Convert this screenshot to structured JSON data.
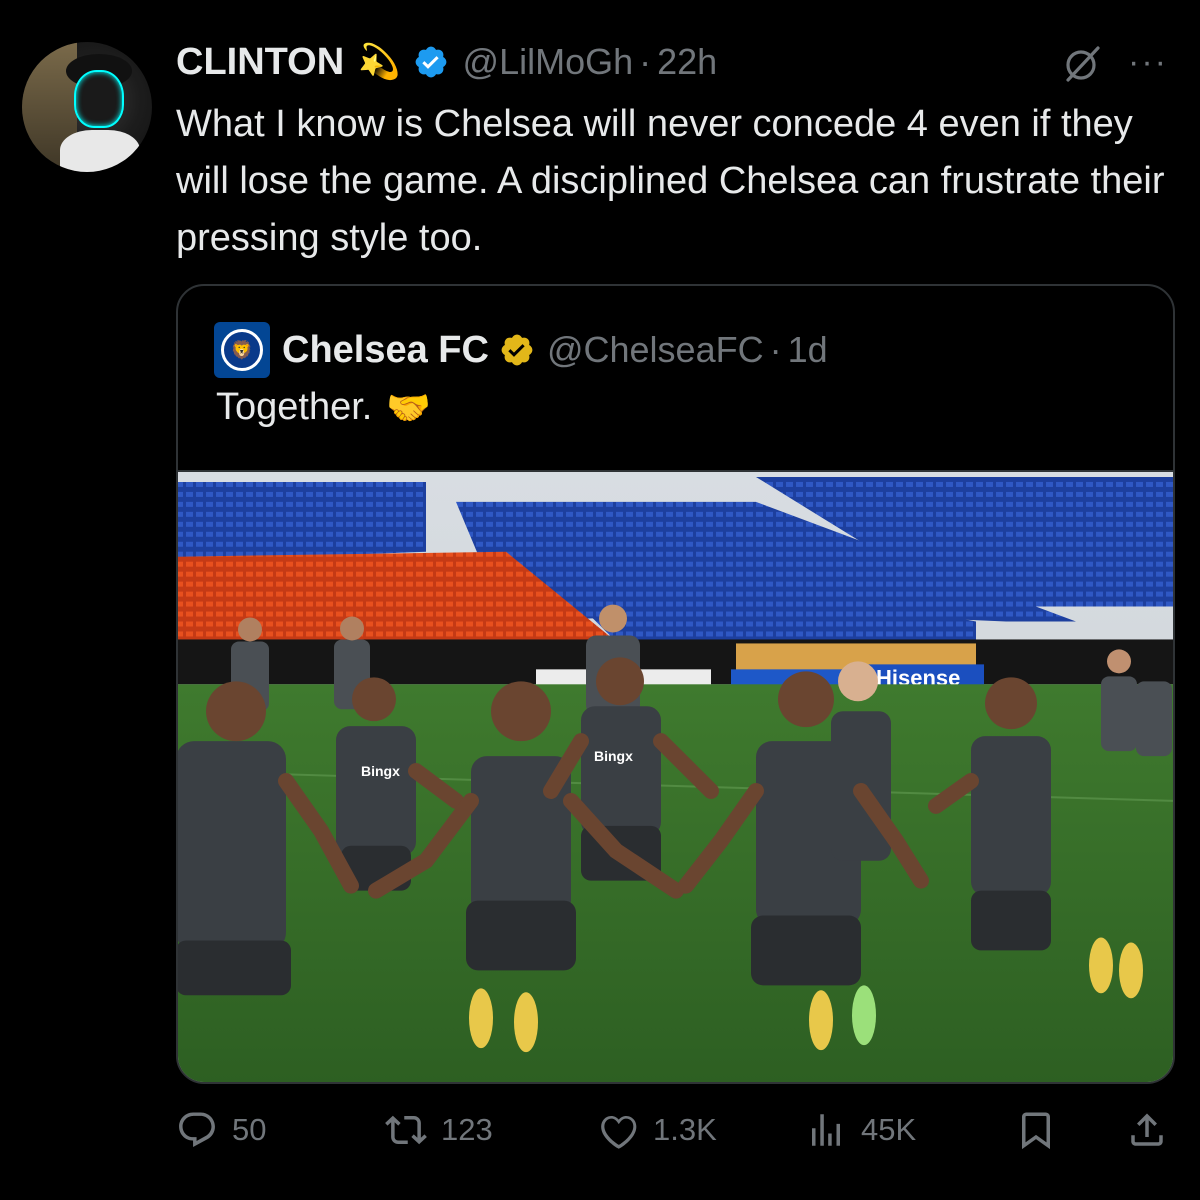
{
  "author": {
    "name": "CLINTON",
    "emoji": "💫",
    "handle": "@LilMoGh",
    "separator": "·",
    "time": "22h"
  },
  "icons": {
    "verified": "verified-badge-icon",
    "grok": "grok-icon",
    "more": "more-options-icon",
    "reply": "reply-icon",
    "repost": "repost-icon",
    "like": "like-icon",
    "views": "views-icon",
    "bookmark": "bookmark-icon",
    "share": "share-icon"
  },
  "tweet": {
    "text": "What I know is Chelsea will never concede 4 even if they will lose the game. A disciplined Chelsea can frustrate their pressing style too."
  },
  "quoted": {
    "name": "Chelsea FC",
    "handle": "@ChelseaFC",
    "separator": "·",
    "time": "1d",
    "text": "Together.",
    "emoji": "🤝",
    "photo": {
      "sponsor_board": "Hisense",
      "shirt_sponsor": "Bingx"
    }
  },
  "actions": {
    "replies": "50",
    "reposts": "123",
    "likes": "1.3K",
    "views": "45K"
  },
  "colors": {
    "background": "#000000",
    "text": "#e7e9ea",
    "muted": "#71767b",
    "verified_blue": "#1d9bf0",
    "verified_gold": "#e2b719",
    "border": "#2f3336"
  }
}
